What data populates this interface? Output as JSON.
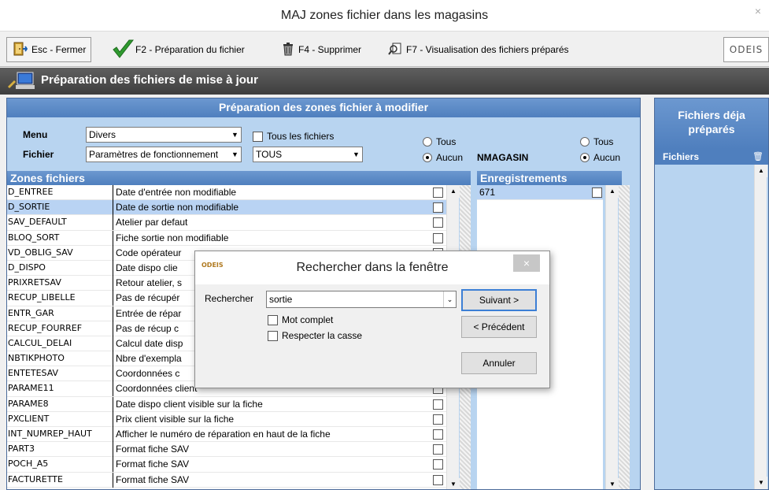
{
  "window": {
    "title": "MAJ zones fichier dans les magasins",
    "close_glyph": "×"
  },
  "toolbar": {
    "esc_label": "Esc - Fermer",
    "f2_label": "F2 - Préparation du fichier",
    "f4_label": "F4 - Supprimer",
    "f7_label": "F7 - Visualisation des fichiers préparés",
    "logo_text": "ODEIS"
  },
  "header": {
    "title": "Préparation des fichiers de mise à jour"
  },
  "form": {
    "section_title": "Préparation des zones fichier à modifier",
    "menu_label": "Menu",
    "menu_value": "Divers",
    "fichier_label": "Fichier",
    "fichier_value": "Paramètres de fonctionnement",
    "all_files_label": "Tous les fichiers",
    "filter_value": "TOUS",
    "radio_tous": "Tous",
    "radio_aucun": "Aucun",
    "nmagasin_label": "NMAGASIN",
    "radio2_tous": "Tous",
    "radio2_aucun": "Aucun"
  },
  "zones": {
    "title": "Zones fichiers",
    "rows": [
      {
        "code": "D_ENTREE",
        "desc": "Date d'entrée non modifiable"
      },
      {
        "code": "D_SORTIE",
        "desc": "Date de sortie non modifiable"
      },
      {
        "code": "SAV_DEFAULT",
        "desc": "Atelier par defaut"
      },
      {
        "code": "BLOQ_SORT",
        "desc": "Fiche sortie non modifiable"
      },
      {
        "code": "VD_OBLIG_SAV",
        "desc": "Code opérateur"
      },
      {
        "code": "D_DISPO",
        "desc": "Date dispo clie"
      },
      {
        "code": "PRIXRETSAV",
        "desc": "Retour atelier, s"
      },
      {
        "code": "RECUP_LIBELLE",
        "desc": "Pas de récupér"
      },
      {
        "code": "ENTR_GAR",
        "desc": "Entrée de répar"
      },
      {
        "code": "RECUP_FOURREF",
        "desc": "Pas de récup c"
      },
      {
        "code": "CALCUL_DELAI",
        "desc": "Calcul date disp"
      },
      {
        "code": "NBTIKPHOTO",
        "desc": "Nbre d'exempla"
      },
      {
        "code": "ENTETESAV",
        "desc": "Coordonnées c"
      },
      {
        "code": "PARAME11",
        "desc": "Coordonnées client"
      },
      {
        "code": "PARAME8",
        "desc": "Date dispo client visible sur la fiche"
      },
      {
        "code": "PXCLIENT",
        "desc": "Prix client visible sur la fiche"
      },
      {
        "code": "INT_NUMREP_HAUT",
        "desc": "Afficher le numéro de réparation en haut de la fiche"
      },
      {
        "code": "PART3",
        "desc": "Format fiche SAV"
      },
      {
        "code": "POCH_A5",
        "desc": "Format fiche SAV"
      },
      {
        "code": "FACTURETTE",
        "desc": "Format fiche SAV"
      }
    ]
  },
  "enregistrements": {
    "title": "Enregistrements",
    "rows": [
      {
        "value": "671"
      }
    ]
  },
  "side": {
    "title": "Fichiers déja préparés",
    "col_header": "Fichiers"
  },
  "dialog": {
    "title": "Rechercher dans la fenêtre",
    "logo_text": "ODEIS",
    "search_label": "Rechercher",
    "search_value": "sortie",
    "whole_word_label": "Mot complet",
    "match_case_label": "Respecter la casse",
    "next_button": "Suivant >",
    "prev_button": "< Précédent",
    "cancel_button": "Annuler",
    "close_glyph": "×"
  }
}
